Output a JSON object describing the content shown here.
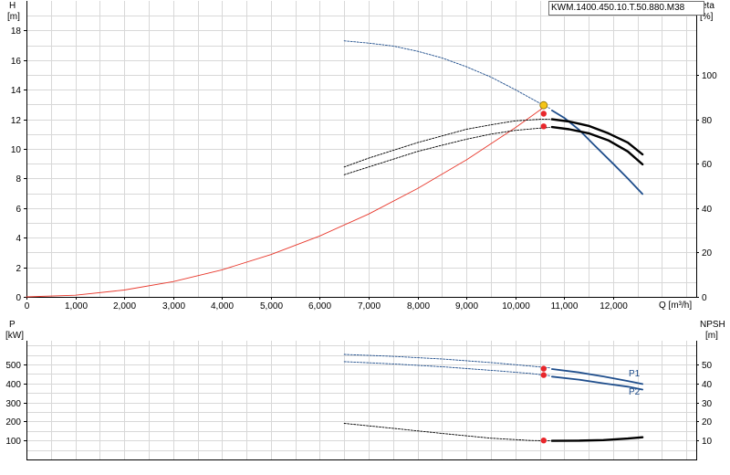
{
  "model": "KWM.1400.450.10.T.50.880.M38",
  "colors": {
    "grid": "#d8d8d8",
    "axis": "#000000",
    "head_curve": "#1f4e8c",
    "power_curve": "#1f4e8c",
    "eta_curve": "#000000",
    "npsh_curve": "#000000",
    "system_curve": "#e8382c",
    "op_point": "#f5c518",
    "marker": "#e8262b"
  },
  "chart_data": [
    {
      "id": "top",
      "type": "line",
      "x_axis": {
        "label": "Q [m³/h]",
        "lim": [
          0,
          13700
        ],
        "ticks": [
          0,
          1000,
          2000,
          3000,
          4000,
          5000,
          6000,
          7000,
          8000,
          9000,
          10000,
          11000,
          12000
        ],
        "tick_labels": [
          "0",
          "1,000",
          "2,000",
          "3,000",
          "4,000",
          "5,000",
          "6,000",
          "7,000",
          "8,000",
          "9,000",
          "10,000",
          "11,000",
          "12,000"
        ]
      },
      "y_left": {
        "label_top": "H",
        "label_unit": "[m]",
        "lim": [
          0,
          20
        ],
        "ticks": [
          0,
          2,
          4,
          6,
          8,
          10,
          12,
          14,
          16,
          18
        ],
        "tick_labels": [
          "0",
          "2",
          "4",
          "6",
          "8",
          "10",
          "12",
          "14",
          "16",
          "18"
        ]
      },
      "y_right": {
        "label_top": "eta",
        "label_unit": "[%]",
        "lim": [
          0,
          133.3
        ],
        "ticks": [
          0,
          20,
          40,
          60,
          80,
          100
        ],
        "tick_labels": [
          "0",
          "20",
          "40",
          "60",
          "80",
          "100"
        ]
      },
      "grid": true,
      "series": [
        {
          "key": "head_ext",
          "axis": "left",
          "style": "dotted",
          "color_key": "head_curve",
          "x": [
            6500,
            7000,
            7500,
            8000,
            8500,
            9000,
            9500,
            10000,
            10300,
            10550,
            10700
          ],
          "y": [
            17.3,
            17.15,
            16.95,
            16.6,
            16.15,
            15.55,
            14.85,
            14.0,
            13.45,
            13.0,
            12.75
          ]
        },
        {
          "key": "head",
          "axis": "left",
          "style": "solid",
          "color_key": "head_curve",
          "x": [
            10750,
            11000,
            11300,
            11600,
            12000,
            12300,
            12600
          ],
          "y": [
            12.6,
            12.1,
            11.3,
            10.3,
            9.0,
            8.0,
            6.95
          ]
        },
        {
          "key": "system",
          "axis": "left",
          "style": "thin",
          "color_key": "system_curve",
          "x": [
            0,
            1000,
            2000,
            3000,
            4000,
            5000,
            6000,
            7000,
            8000,
            9000,
            10000,
            10600
          ],
          "y": [
            0,
            0.11,
            0.46,
            1.03,
            1.83,
            2.86,
            4.12,
            5.6,
            7.32,
            9.26,
            11.43,
            12.85
          ]
        },
        {
          "key": "eta1_ext",
          "axis": "right",
          "style": "dotted",
          "color_key": "eta_curve",
          "x": [
            6500,
            7000,
            7500,
            8000,
            8500,
            9000,
            9500,
            10000,
            10500,
            10700
          ],
          "y": [
            58.5,
            62.5,
            66.0,
            69.5,
            72.5,
            75.5,
            77.5,
            79.3,
            80.0,
            80.0
          ]
        },
        {
          "key": "eta1",
          "axis": "right",
          "style": "thick",
          "color_key": "eta_curve",
          "x": [
            10750,
            11100,
            11500,
            11900,
            12300,
            12600
          ],
          "y": [
            80.0,
            79.0,
            77.0,
            73.7,
            69.5,
            64.2
          ]
        },
        {
          "key": "eta2_ext",
          "axis": "right",
          "style": "dotted",
          "color_key": "eta_curve",
          "x": [
            6500,
            7000,
            7500,
            8000,
            8500,
            9000,
            9500,
            10000,
            10500,
            10700
          ],
          "y": [
            55.0,
            58.5,
            62.0,
            65.5,
            68.3,
            71.0,
            73.3,
            75.0,
            76.0,
            76.3
          ]
        },
        {
          "key": "eta2",
          "axis": "right",
          "style": "thick",
          "color_key": "eta_curve",
          "x": [
            10750,
            11100,
            11500,
            11900,
            12300,
            12600
          ],
          "y": [
            76.5,
            75.5,
            73.7,
            70.5,
            65.5,
            59.7
          ]
        }
      ],
      "markers": [
        {
          "key": "op-point",
          "axis": "left",
          "x": 10580,
          "y": 12.95,
          "color_key": "op_point",
          "r": 4
        },
        {
          "key": "eta1-marker",
          "axis": "right",
          "x": 10580,
          "y": 82.5,
          "color_key": "marker",
          "r": 3.2
        },
        {
          "key": "eta2-marker",
          "axis": "right",
          "x": 10580,
          "y": 76.8,
          "color_key": "marker",
          "r": 3.2
        }
      ]
    },
    {
      "id": "bottom",
      "type": "line",
      "x_axis": {
        "lim": [
          0,
          13700
        ]
      },
      "y_left": {
        "label_top": "P",
        "label_unit": "[kW]",
        "lim": [
          0,
          625
        ],
        "ticks": [
          100,
          200,
          300,
          400,
          500
        ],
        "tick_labels": [
          "100",
          "200",
          "300",
          "400",
          "500"
        ]
      },
      "y_right": {
        "label_top": "NPSH",
        "label_unit": "[m]",
        "lim": [
          0,
          62.5
        ],
        "ticks": [
          10,
          20,
          30,
          40,
          50
        ],
        "tick_labels": [
          "10",
          "20",
          "30",
          "40",
          "50"
        ]
      },
      "grid": true,
      "series": [
        {
          "key": "p1_ext",
          "axis": "left",
          "style": "dotted",
          "color_key": "power_curve",
          "x": [
            6500,
            7500,
            8500,
            9500,
            10300,
            10700
          ],
          "y": [
            553,
            543,
            529,
            510,
            492,
            482
          ]
        },
        {
          "key": "p1",
          "axis": "left",
          "style": "solid",
          "color_key": "power_curve",
          "x": [
            10750,
            11300,
            11800,
            12300,
            12600
          ],
          "y": [
            476,
            458,
            437,
            413,
            397
          ],
          "label": "P1"
        },
        {
          "key": "p2_ext",
          "axis": "left",
          "style": "dotted",
          "color_key": "power_curve",
          "x": [
            6500,
            7500,
            8500,
            9500,
            10300,
            10700
          ],
          "y": [
            515,
            503,
            488,
            469,
            453,
            441
          ]
        },
        {
          "key": "p2",
          "axis": "left",
          "style": "solid",
          "color_key": "power_curve",
          "x": [
            10750,
            11300,
            11800,
            12300,
            12600
          ],
          "y": [
            436,
            420,
            401,
            383,
            368
          ],
          "label": "P2"
        },
        {
          "key": "npsh_ext",
          "axis": "right",
          "style": "dotted",
          "color_key": "npsh_curve",
          "x": [
            6500,
            7500,
            8500,
            9500,
            10300,
            10700
          ],
          "y": [
            19.0,
            16.4,
            13.7,
            11.2,
            10.0,
            9.8
          ]
        },
        {
          "key": "npsh",
          "axis": "right",
          "style": "thick",
          "color_key": "npsh_curve",
          "x": [
            10750,
            11300,
            11800,
            12300,
            12600
          ],
          "y": [
            9.8,
            9.9,
            10.2,
            11.0,
            11.7
          ]
        }
      ],
      "markers": [
        {
          "key": "p1-marker",
          "axis": "left",
          "x": 10580,
          "y": 478,
          "color_key": "marker",
          "r": 3.2
        },
        {
          "key": "p2-marker",
          "axis": "left",
          "x": 10580,
          "y": 444,
          "color_key": "marker",
          "r": 3.2
        },
        {
          "key": "npsh-marker",
          "axis": "right",
          "x": 10580,
          "y": 10.0,
          "color_key": "marker",
          "r": 3.2
        }
      ]
    }
  ]
}
